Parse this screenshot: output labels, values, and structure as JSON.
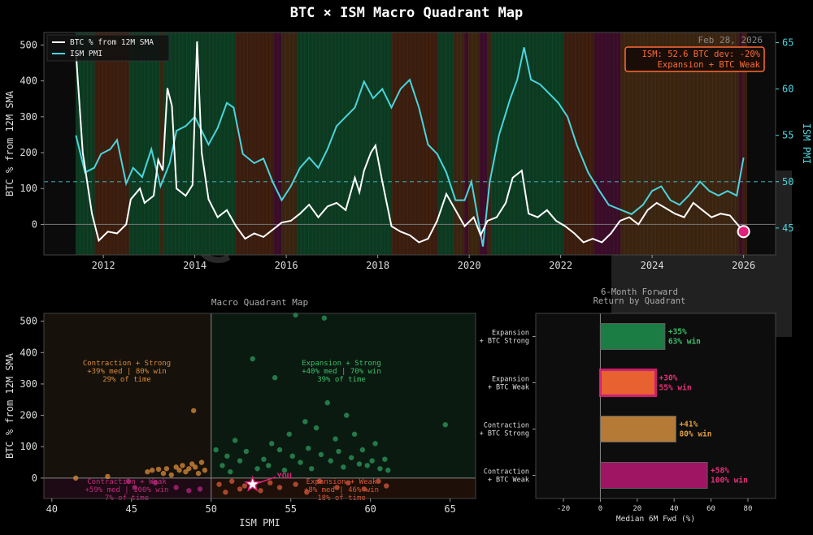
{
  "page_title": "BTC × ISM Macro Quadrant Map",
  "watermark": "@DURDENBTC",
  "colors": {
    "btc_line": "#ffffff",
    "ism_line": "#4ad4dc",
    "expansion_strong": "#1e8a4a",
    "expansion_weak": "#ff6b35",
    "contraction_strong": "#c8863a",
    "contraction_weak": "#b0156e",
    "you_marker": "#e0207a"
  },
  "chart_data": [
    {
      "type": "line",
      "legend": [
        "BTC % from 12M SMA",
        "ISM PMI"
      ],
      "legend_position": "top-left",
      "ylabel_left": "BTC % from 12M SMA",
      "ylabel_right": "ISM PMI",
      "date_label": "Feb 28, 2026",
      "info_box": {
        "line1": "ISM: 52.6    BTC dev: -20%",
        "line2": "Expansion + BTC Weak"
      },
      "x_ticks": [
        "2012",
        "2014",
        "2016",
        "2018",
        "2020",
        "2022",
        "2024",
        "2026"
      ],
      "x_range": [
        2010.7,
        2026.7
      ],
      "y_left_ticks": [
        0,
        100,
        200,
        300,
        400,
        500
      ],
      "y_left_range": [
        -85,
        535
      ],
      "y_right_ticks": [
        45,
        50,
        55,
        60,
        65
      ],
      "y_right_range": [
        42.1,
        66.1
      ],
      "ism_reference": 50,
      "btc_series": [
        [
          2011.4,
          480
        ],
        [
          2011.55,
          200
        ],
        [
          2011.75,
          30
        ],
        [
          2011.9,
          -45
        ],
        [
          2012.1,
          -20
        ],
        [
          2012.3,
          -25
        ],
        [
          2012.5,
          0
        ],
        [
          2012.6,
          70
        ],
        [
          2012.8,
          100
        ],
        [
          2012.9,
          60
        ],
        [
          2013.1,
          80
        ],
        [
          2013.2,
          180
        ],
        [
          2013.3,
          150
        ],
        [
          2013.4,
          380
        ],
        [
          2013.5,
          330
        ],
        [
          2013.6,
          100
        ],
        [
          2013.8,
          80
        ],
        [
          2013.95,
          110
        ],
        [
          2014.05,
          510
        ],
        [
          2014.15,
          200
        ],
        [
          2014.3,
          70
        ],
        [
          2014.5,
          20
        ],
        [
          2014.7,
          40
        ],
        [
          2014.9,
          -5
        ],
        [
          2015.1,
          -40
        ],
        [
          2015.3,
          -25
        ],
        [
          2015.5,
          -35
        ],
        [
          2015.7,
          -15
        ],
        [
          2015.9,
          5
        ],
        [
          2016.1,
          10
        ],
        [
          2016.3,
          30
        ],
        [
          2016.5,
          55
        ],
        [
          2016.7,
          20
        ],
        [
          2016.9,
          50
        ],
        [
          2017.1,
          60
        ],
        [
          2017.3,
          40
        ],
        [
          2017.5,
          130
        ],
        [
          2017.6,
          90
        ],
        [
          2017.7,
          150
        ],
        [
          2017.85,
          200
        ],
        [
          2017.95,
          220
        ],
        [
          2018.1,
          120
        ],
        [
          2018.3,
          -5
        ],
        [
          2018.5,
          -20
        ],
        [
          2018.7,
          -30
        ],
        [
          2018.9,
          -50
        ],
        [
          2019.1,
          -40
        ],
        [
          2019.3,
          10
        ],
        [
          2019.5,
          85
        ],
        [
          2019.7,
          40
        ],
        [
          2019.9,
          -5
        ],
        [
          2020.1,
          20
        ],
        [
          2020.25,
          -30
        ],
        [
          2020.4,
          10
        ],
        [
          2020.6,
          20
        ],
        [
          2020.8,
          60
        ],
        [
          2020.95,
          130
        ],
        [
          2021.15,
          150
        ],
        [
          2021.3,
          30
        ],
        [
          2021.5,
          20
        ],
        [
          2021.7,
          40
        ],
        [
          2021.9,
          10
        ],
        [
          2022.1,
          -5
        ],
        [
          2022.3,
          -25
        ],
        [
          2022.5,
          -50
        ],
        [
          2022.7,
          -40
        ],
        [
          2022.9,
          -50
        ],
        [
          2023.1,
          -25
        ],
        [
          2023.3,
          10
        ],
        [
          2023.5,
          20
        ],
        [
          2023.7,
          0
        ],
        [
          2023.9,
          40
        ],
        [
          2024.1,
          60
        ],
        [
          2024.3,
          45
        ],
        [
          2024.5,
          30
        ],
        [
          2024.7,
          20
        ],
        [
          2024.9,
          60
        ],
        [
          2025.1,
          40
        ],
        [
          2025.3,
          20
        ],
        [
          2025.5,
          30
        ],
        [
          2025.7,
          25
        ],
        [
          2025.9,
          -5
        ],
        [
          2026.0,
          -20
        ]
      ],
      "ism_series": [
        [
          2011.4,
          55
        ],
        [
          2011.6,
          51
        ],
        [
          2011.8,
          51.5
        ],
        [
          2011.95,
          53
        ],
        [
          2012.15,
          53.5
        ],
        [
          2012.3,
          54.5
        ],
        [
          2012.5,
          49.8
        ],
        [
          2012.65,
          51.5
        ],
        [
          2012.85,
          50.5
        ],
        [
          2013.05,
          53.5
        ],
        [
          2013.25,
          49.5
        ],
        [
          2013.45,
          52
        ],
        [
          2013.6,
          55.5
        ],
        [
          2013.8,
          56
        ],
        [
          2014.0,
          57
        ],
        [
          2014.15,
          55.5
        ],
        [
          2014.3,
          54
        ],
        [
          2014.5,
          55.8
        ],
        [
          2014.7,
          58.5
        ],
        [
          2014.85,
          58
        ],
        [
          2015.05,
          53
        ],
        [
          2015.3,
          52
        ],
        [
          2015.5,
          52.5
        ],
        [
          2015.7,
          50
        ],
        [
          2015.9,
          48
        ],
        [
          2016.1,
          49.5
        ],
        [
          2016.3,
          51.5
        ],
        [
          2016.5,
          52.6
        ],
        [
          2016.7,
          51.5
        ],
        [
          2016.9,
          53.5
        ],
        [
          2017.1,
          56
        ],
        [
          2017.3,
          57
        ],
        [
          2017.5,
          58
        ],
        [
          2017.7,
          60.8
        ],
        [
          2017.9,
          59
        ],
        [
          2018.1,
          60
        ],
        [
          2018.3,
          58
        ],
        [
          2018.5,
          60
        ],
        [
          2018.7,
          61
        ],
        [
          2018.9,
          58
        ],
        [
          2019.1,
          54
        ],
        [
          2019.3,
          53
        ],
        [
          2019.5,
          51
        ],
        [
          2019.7,
          48
        ],
        [
          2019.9,
          48
        ],
        [
          2020.05,
          50
        ],
        [
          2020.3,
          43
        ],
        [
          2020.45,
          50
        ],
        [
          2020.65,
          55
        ],
        [
          2020.9,
          59
        ],
        [
          2021.05,
          61
        ],
        [
          2021.2,
          64.5
        ],
        [
          2021.35,
          61
        ],
        [
          2021.55,
          60.5
        ],
        [
          2021.75,
          59.5
        ],
        [
          2021.95,
          58.5
        ],
        [
          2022.15,
          57
        ],
        [
          2022.35,
          54
        ],
        [
          2022.6,
          51
        ],
        [
          2022.85,
          49
        ],
        [
          2023.05,
          47.5
        ],
        [
          2023.3,
          47
        ],
        [
          2023.55,
          46.5
        ],
        [
          2023.8,
          47.5
        ],
        [
          2024.0,
          49
        ],
        [
          2024.2,
          49.5
        ],
        [
          2024.4,
          48
        ],
        [
          2024.6,
          47.5
        ],
        [
          2024.8,
          48.5
        ],
        [
          2025.05,
          50
        ],
        [
          2025.25,
          49
        ],
        [
          2025.45,
          48.5
        ],
        [
          2025.65,
          49
        ],
        [
          2025.85,
          48.5
        ],
        [
          2026.0,
          52.6
        ]
      ]
    },
    {
      "type": "scatter",
      "title": "Macro Quadrant Map",
      "xlabel": "ISM PMI",
      "ylabel": "BTC % from 12M SMA",
      "xlim": [
        39.5,
        66.6
      ],
      "ylim": [
        -65,
        525
      ],
      "x_ticks": [
        40,
        45,
        50,
        55,
        60,
        65
      ],
      "y_ticks": [
        0,
        100,
        200,
        300,
        400,
        500
      ],
      "quadrant_labels": [
        {
          "key": "contraction_strong",
          "lines": [
            "Contraction + Strong",
            "+39% med | 80% win",
            "29% of time"
          ]
        },
        {
          "key": "expansion_strong",
          "lines": [
            "Expansion + Strong",
            "+40% med | 70% win",
            "39% of time"
          ]
        },
        {
          "key": "contraction_weak",
          "lines": [
            "Contraction + Weak",
            "+59% med | 100% win",
            "7% of time"
          ]
        },
        {
          "key": "expansion_weak",
          "lines": [
            "Expansion + Weak",
            "+8% med | 46% win",
            "18% of time"
          ]
        }
      ],
      "you_label": "YOU",
      "you_point": [
        52.6,
        -20
      ],
      "points": [
        [
          41.5,
          0
        ],
        [
          43.5,
          5
        ],
        [
          44.8,
          -10
        ],
        [
          45.2,
          -30
        ],
        [
          46,
          20
        ],
        [
          46.3,
          25
        ],
        [
          46.7,
          28
        ],
        [
          47,
          15
        ],
        [
          47.2,
          30
        ],
        [
          47.5,
          10
        ],
        [
          47.8,
          35
        ],
        [
          48,
          25
        ],
        [
          48.2,
          40
        ],
        [
          48.4,
          20
        ],
        [
          48.6,
          30
        ],
        [
          48.8,
          45
        ],
        [
          49,
          35
        ],
        [
          49.2,
          15
        ],
        [
          49.4,
          50
        ],
        [
          49.6,
          25
        ],
        [
          48.9,
          215
        ],
        [
          47.8,
          -30
        ],
        [
          48.6,
          -40
        ],
        [
          46.5,
          -15
        ],
        [
          49.3,
          -35
        ],
        [
          50.3,
          90
        ],
        [
          50.7,
          40
        ],
        [
          51,
          70
        ],
        [
          51.2,
          20
        ],
        [
          51.5,
          120
        ],
        [
          51.8,
          55
        ],
        [
          52.2,
          85
        ],
        [
          52.6,
          380
        ],
        [
          52.9,
          30
        ],
        [
          53.3,
          60
        ],
        [
          53.6,
          40
        ],
        [
          53.8,
          110
        ],
        [
          54,
          320
        ],
        [
          54.3,
          90
        ],
        [
          54.6,
          25
        ],
        [
          54.9,
          140
        ],
        [
          55.1,
          70
        ],
        [
          55.3,
          520
        ],
        [
          55.6,
          50
        ],
        [
          55.9,
          180
        ],
        [
          56.1,
          95
        ],
        [
          56.3,
          30
        ],
        [
          56.6,
          160
        ],
        [
          56.9,
          75
        ],
        [
          57.1,
          510
        ],
        [
          57.3,
          240
        ],
        [
          57.5,
          55
        ],
        [
          57.8,
          125
        ],
        [
          58,
          85
        ],
        [
          58.3,
          35
        ],
        [
          58.5,
          200
        ],
        [
          58.8,
          65
        ],
        [
          59,
          140
        ],
        [
          59.3,
          45
        ],
        [
          59.5,
          90
        ],
        [
          59.8,
          40
        ],
        [
          60.1,
          55
        ],
        [
          60.3,
          110
        ],
        [
          60.6,
          30
        ],
        [
          60.9,
          60
        ],
        [
          61.1,
          25
        ],
        [
          64.7,
          170
        ],
        [
          50.5,
          -20
        ],
        [
          50.9,
          -45
        ],
        [
          51.3,
          -10
        ],
        [
          51.8,
          -35
        ],
        [
          52.1,
          -25
        ],
        [
          53.1,
          -40
        ],
        [
          53.7,
          -15
        ],
        [
          54.3,
          -30
        ],
        [
          55.3,
          -20
        ],
        [
          56,
          -45
        ],
        [
          56.8,
          -10
        ],
        [
          57.9,
          -30
        ],
        [
          58.6,
          -15
        ],
        [
          59.6,
          -35
        ],
        [
          60.5,
          -10
        ],
        [
          61,
          -25
        ]
      ],
      "point_colors": {
        "expansion_strong": "#2e9a5c",
        "expansion_weak": "#d9593a",
        "contraction_strong": "#d98c3a",
        "contraction_weak": "#b52682"
      }
    },
    {
      "type": "bar",
      "orientation": "horizontal",
      "title": "6-Month Forward\nReturn by Quadrant",
      "title_lines": [
        "6-Month Forward",
        "Return by Quadrant"
      ],
      "xlabel": "Median 6M Fwd (%)",
      "xlim": [
        -35,
        95
      ],
      "x_ticks": [
        -20,
        0,
        20,
        40,
        60,
        80
      ],
      "categories": [
        [
          "Expansion",
          "+ BTC Strong"
        ],
        [
          "Expansion",
          "+ BTC Weak"
        ],
        [
          "Contraction",
          "+ BTC Strong"
        ],
        [
          "Contraction",
          "+ BTC Weak"
        ]
      ],
      "values": [
        35,
        30,
        41,
        58
      ],
      "labels": [
        [
          "+35%",
          "63% win"
        ],
        [
          "+30%",
          "55% win"
        ],
        [
          "+41%",
          "80% win"
        ],
        [
          "+58%",
          "100% win"
        ]
      ],
      "bar_colors": [
        "#1e8a4a",
        "#ff6b35",
        "#c8863a",
        "#b0156e"
      ],
      "label_colors": [
        "#3ac06a",
        "#e8307a",
        "#e0a040",
        "#e8307a"
      ],
      "highlight_index": 1
    }
  ]
}
